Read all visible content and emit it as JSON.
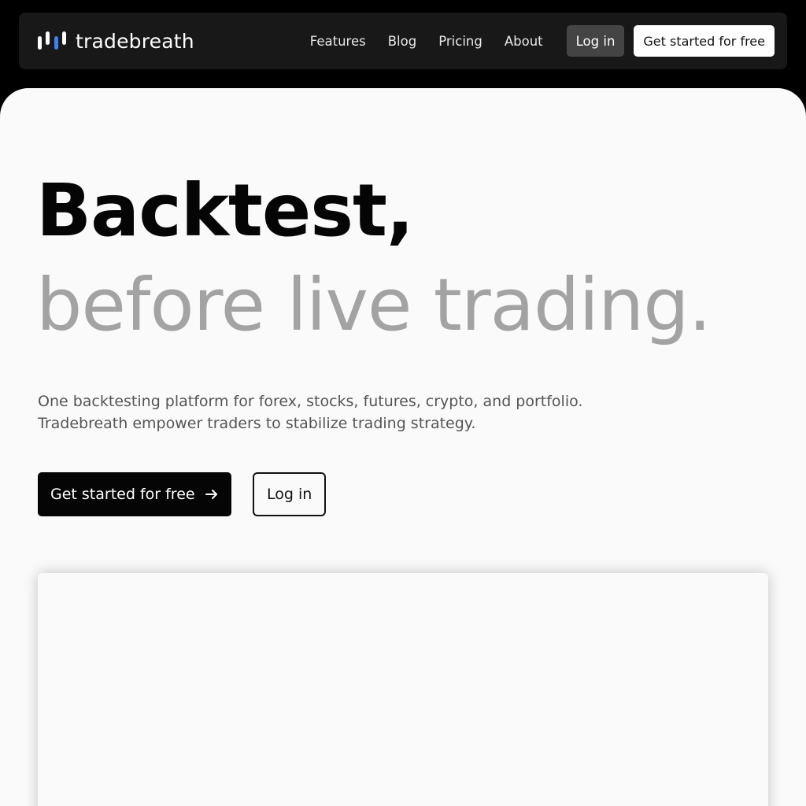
{
  "brand": {
    "name": "tradebreath",
    "accent_color": "#3b82f6",
    "logo_icon": "bar-chart-logo-icon"
  },
  "nav": {
    "links": [
      {
        "label": "Features"
      },
      {
        "label": "Blog"
      },
      {
        "label": "Pricing"
      },
      {
        "label": "About"
      }
    ],
    "login_label": "Log in",
    "cta_label": "Get started for free"
  },
  "hero": {
    "headline_line1": "Backtest,",
    "headline_line2": "before live trading.",
    "subtext_line1": "One backtesting platform for forex, stocks, futures, crypto, and portfolio.",
    "subtext_line2": "Tradebreath empower traders to stabilize trading strategy.",
    "primary_cta_label": "Get started for free",
    "primary_cta_icon": "arrow-right-icon",
    "secondary_cta_label": "Log in"
  }
}
